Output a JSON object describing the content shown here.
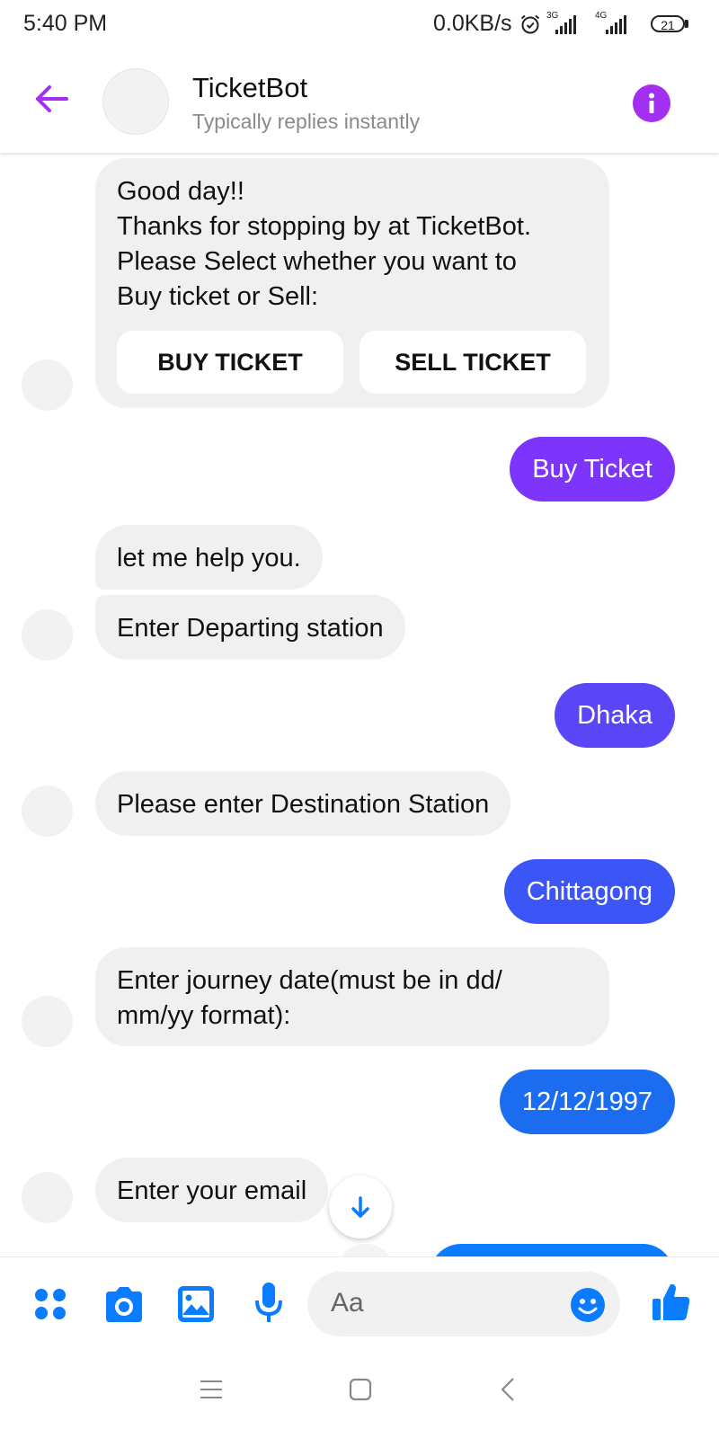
{
  "status_bar": {
    "time": "5:40 PM",
    "net_speed": "0.0KB/s",
    "network_1": "3G",
    "network_2": "4G",
    "battery": "21"
  },
  "header": {
    "name": "TicketBot",
    "status": "Typically replies instantly"
  },
  "messages": {
    "welcome": {
      "lines": [
        "Good day!!",
        "Thanks for stopping by at TicketBot.",
        "Please Select whether you want to",
        "Buy ticket or Sell:"
      ],
      "buttons": [
        "BUY TICKET",
        "SELL TICKET"
      ]
    },
    "user_1": "Buy Ticket",
    "bot_2": "let me help you.",
    "bot_3": "Enter Departing station",
    "user_2": "Dhaka",
    "bot_4": "Please enter Destination Station",
    "user_3": "Chittagong",
    "bot_5_lines": [
      "Enter journey date(must be in dd/",
      "mm/yy format):"
    ],
    "user_4": "12/12/1997",
    "bot_6": "Enter your email"
  },
  "composer": {
    "placeholder": "Aa"
  },
  "colors": {
    "accent_purple": "#a32ff2",
    "bubble_buy": "#7d35fb",
    "bubble_dhaka": "#5a46f7",
    "bubble_chittagong": "#3b55f6",
    "bubble_date": "#1c6cf0",
    "messenger_blue": "#0a7cff"
  },
  "icons": [
    "back-arrow-icon",
    "info-icon",
    "arrow-down-icon",
    "apps-icon",
    "camera-icon",
    "gallery-icon",
    "microphone-icon",
    "emoji-icon",
    "thumbs-up-icon",
    "menu-icon",
    "home-icon",
    "back-icon"
  ]
}
